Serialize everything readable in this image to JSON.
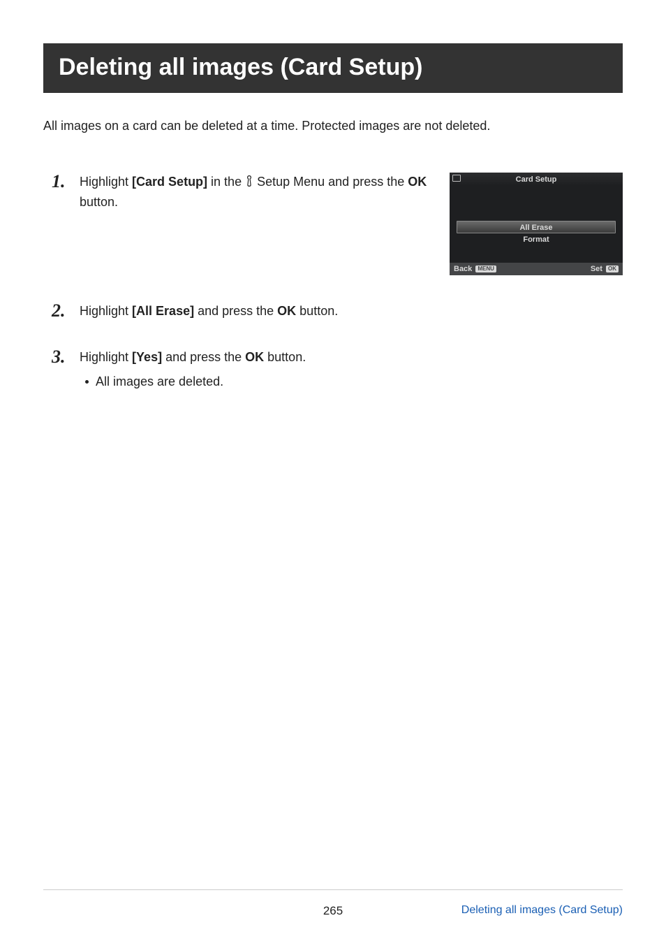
{
  "title": "Deleting all images (Card Setup)",
  "intro": "All images on a card can be deleted at a time. Protected images are not deleted.",
  "steps": [
    {
      "num": "1",
      "seg_a": "Highlight ",
      "bold_a": "[Card Setup]",
      "seg_b": " in the ",
      "seg_c": " Setup Menu and press the ",
      "bold_b": "OK",
      "seg_d": " button."
    },
    {
      "num": "2",
      "seg_a": "Highlight ",
      "bold_a": "[All Erase]",
      "seg_b": " and press the ",
      "bold_b": "OK",
      "seg_c": " button."
    },
    {
      "num": "3",
      "seg_a": "Highlight ",
      "bold_a": "[Yes]",
      "seg_b": " and press the ",
      "bold_b": "OK",
      "seg_c": " button.",
      "sub": "All images are deleted."
    }
  ],
  "menu": {
    "title": "Card Setup",
    "row1": "All Erase",
    "row2": "Format",
    "back": "Back",
    "back_tag": "MENU",
    "set": "Set",
    "set_tag": "OK"
  },
  "footer": {
    "page": "265",
    "link": "Deleting all images (Card Setup)"
  }
}
